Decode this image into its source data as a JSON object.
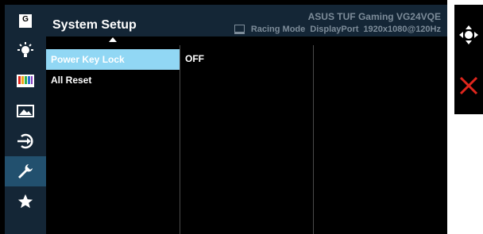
{
  "header": {
    "title": "System Setup",
    "model": "ASUS TUF Gaming VG24VQE",
    "mode": "Racing Mode",
    "input": "DisplayPort",
    "resolution": "1920x1080@120Hz"
  },
  "sidebar": {
    "items": [
      {
        "name": "gameplus",
        "icon": "g-icon",
        "glyph": "G"
      },
      {
        "name": "brightness",
        "icon": "brightness-icon"
      },
      {
        "name": "color",
        "icon": "color-bars-icon"
      },
      {
        "name": "image",
        "icon": "image-icon"
      },
      {
        "name": "input-select",
        "icon": "input-icon"
      },
      {
        "name": "system-setup",
        "icon": "wrench-icon",
        "active": true
      },
      {
        "name": "myfavorite",
        "icon": "star-icon"
      }
    ]
  },
  "menu": {
    "items": [
      {
        "label": "Power Key Lock",
        "selected": true
      },
      {
        "label": "All Reset",
        "selected": false
      }
    ]
  },
  "submenu": {
    "value": "OFF"
  },
  "nav": {
    "move_icon": "dpad-icon",
    "close_icon": "close-icon"
  },
  "colors": {
    "accent": "#91d7f4",
    "sidebar": "#142636",
    "active": "#22506e",
    "close": "#e0261d"
  }
}
